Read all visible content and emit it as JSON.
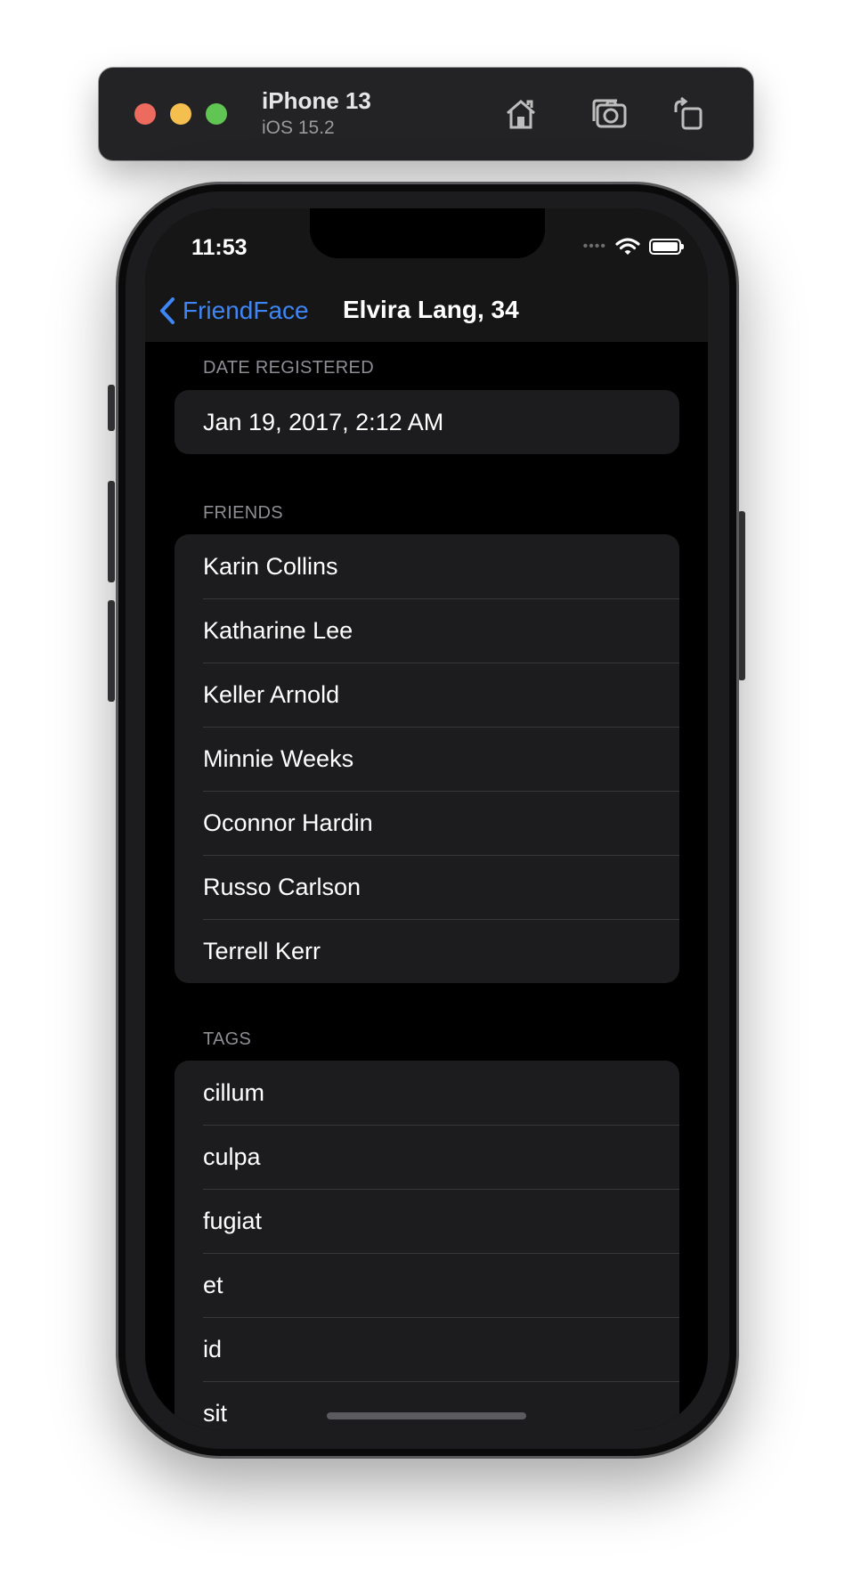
{
  "simulator": {
    "device_name": "iPhone 13",
    "os_version": "iOS 15.2",
    "buttons": [
      "home-icon",
      "screenshot-icon",
      "rotate-icon"
    ]
  },
  "status_bar": {
    "time": "11:53",
    "signal_dots": "••••"
  },
  "nav": {
    "back_label": "FriendFace",
    "title": "Elvira Lang, 34"
  },
  "sections": {
    "date_registered": {
      "header": "DATE REGISTERED",
      "value": "Jan 19, 2017, 2:12 AM"
    },
    "friends": {
      "header": "FRIENDS",
      "items": [
        "Karin Collins",
        "Katharine Lee",
        "Keller Arnold",
        "Minnie Weeks",
        "Oconnor Hardin",
        "Russo Carlson",
        "Terrell Kerr"
      ]
    },
    "tags": {
      "header": "TAGS",
      "items": [
        "cillum",
        "culpa",
        "fugiat",
        "et",
        "id",
        "sit"
      ]
    }
  },
  "colors": {
    "accent": "#3f86f5",
    "background": "#000000",
    "cell": "#1c1c1e"
  }
}
